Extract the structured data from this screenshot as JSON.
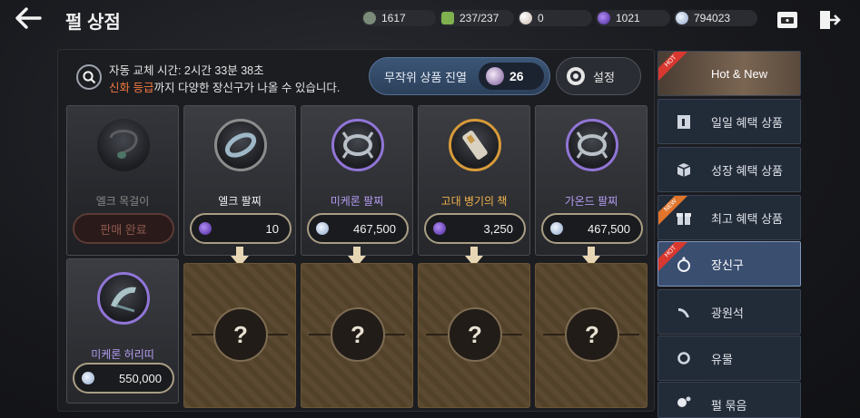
{
  "header": {
    "title": "펄 상점",
    "back_icon": "back-arrow-icon",
    "currencies": [
      {
        "name": "stone",
        "value": "1617",
        "color": "#8a9a86"
      },
      {
        "name": "energy",
        "value": "237/237",
        "color": "#7fb24f"
      },
      {
        "name": "pearl",
        "value": "0",
        "color": "#d8c9c0"
      },
      {
        "name": "purple-gem",
        "value": "1021",
        "color": "#7d4fd0"
      },
      {
        "name": "silver",
        "value": "794023",
        "color": "#c7d6ea"
      }
    ]
  },
  "info": {
    "line1": "자동 교체 시간: 2시간 33분 38초",
    "line2_highlight": "신화 등급",
    "line2_rest": "까지 다양한 장신구가 나올 수 있습니다.",
    "random_label": "무작위 상품 진열",
    "random_count": "26",
    "settings_label": "설정"
  },
  "cards_top": [
    {
      "name": "엘크 목걸이",
      "name_color": "#8a8a8a",
      "sold": true,
      "sold_label": "판매 완료"
    },
    {
      "name": "엘크 팔찌",
      "name_color": "#f2f2f2",
      "price": "10",
      "currency": "purple-gem",
      "ring": "#8c8c8c"
    },
    {
      "name": "미케론 팔찌",
      "name_color": "#b39cf0",
      "price": "467,500",
      "currency": "silver",
      "ring": "#9175d6"
    },
    {
      "name": "고대 병기의 책",
      "name_color": "#f0b34c",
      "price": "3,250",
      "currency": "purple-gem",
      "ring": "#d79a3a"
    },
    {
      "name": "가온드 팔찌",
      "name_color": "#b39cf0",
      "price": "467,500",
      "currency": "silver",
      "ring": "#9175d6"
    }
  ],
  "card_bottom": {
    "name": "미케론 허리띠",
    "name_color": "#b39cf0",
    "price": "550,000",
    "currency": "silver",
    "ring": "#9175d6"
  },
  "locked_mark": "?",
  "sidebar": [
    {
      "label": "Hot & New",
      "tag": "HOT",
      "icon": "banner-image-icon"
    },
    {
      "label": "일일 혜택 상품",
      "icon": "calendar-one-icon"
    },
    {
      "label": "성장 혜택 상품",
      "icon": "box-icon"
    },
    {
      "label": "최고 혜택 상품",
      "tag": "NEW",
      "icon": "gift-box-icon"
    },
    {
      "label": "장신구",
      "tag": "HOT",
      "icon": "ring-icon",
      "selected": true
    },
    {
      "label": "광원석",
      "icon": "mineral-icon"
    },
    {
      "label": "유물",
      "icon": "relic-ring-icon"
    },
    {
      "label": "펄 묶음",
      "icon": "pearl-bundle-icon"
    }
  ]
}
